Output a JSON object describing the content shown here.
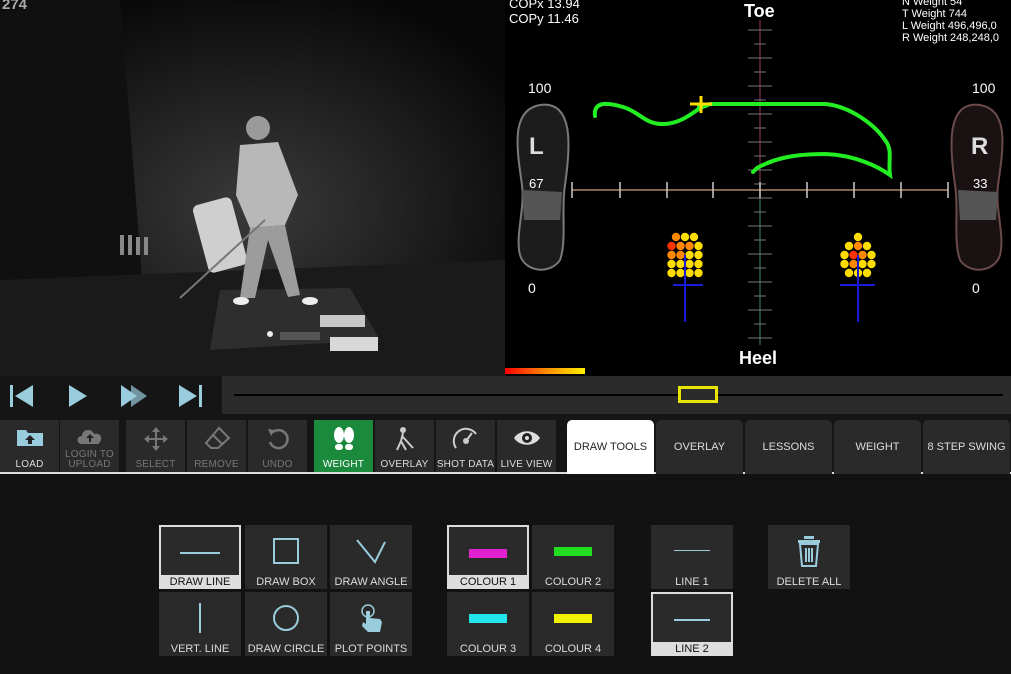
{
  "video": {
    "frame_counter": "274"
  },
  "pressure": {
    "copx": "COPx 13.94",
    "copy": "COPy 11.46",
    "toe_label": "Toe",
    "heel_label": "Heel",
    "weights": [
      "N Weight 54",
      "T Weight 744",
      "L Weight 496,496,0",
      "R Weight 248,248,0"
    ],
    "left_foot": {
      "letter": "L",
      "max": "100",
      "value": "67",
      "min": "0"
    },
    "right_foot": {
      "letter": "R",
      "max": "100",
      "value": "33",
      "min": "0"
    }
  },
  "playback": {
    "position": 0.59
  },
  "toolbar": {
    "tools": [
      {
        "label": "LOAD",
        "icon": "folder-upload-icon",
        "state": "enabled"
      },
      {
        "label": "LOGIN TO",
        "label2": "UPLOAD",
        "icon": "cloud-upload-icon",
        "state": "disabled"
      },
      {
        "label": "SELECT",
        "icon": "move-icon",
        "state": "disabled"
      },
      {
        "label": "REMOVE",
        "icon": "eraser-icon",
        "state": "disabled"
      },
      {
        "label": "UNDO",
        "icon": "undo-icon",
        "state": "disabled"
      },
      {
        "label": "WEIGHT",
        "icon": "footprints-icon",
        "state": "active"
      },
      {
        "label": "OVERLAY",
        "icon": "golfer-icon",
        "state": "enabled"
      },
      {
        "label": "SHOT DATA",
        "icon": "shot-data-icon",
        "state": "enabled"
      },
      {
        "label": "LIVE VIEW",
        "icon": "eye-icon",
        "state": "enabled"
      }
    ],
    "tabs": [
      "DRAW TOOLS",
      "OVERLAY",
      "LESSONS",
      "WEIGHT",
      "8 STEP SWING"
    ],
    "active_tab": "DRAW TOOLS"
  },
  "draw_tools": {
    "shapes": [
      "DRAW LINE",
      "DRAW BOX",
      "DRAW ANGLE",
      "VERT. LINE",
      "DRAW CIRCLE",
      "PLOT POINTS"
    ],
    "selected_shape": "DRAW LINE",
    "colours": [
      {
        "label": "COLOUR 1",
        "color": "#e020d0"
      },
      {
        "label": "COLOUR 2",
        "color": "#22dd22"
      },
      {
        "label": "COLOUR 3",
        "color": "#22e6ee"
      },
      {
        "label": "COLOUR 4",
        "color": "#f2f200"
      }
    ],
    "selected_colour": "COLOUR 1",
    "lines": [
      "LINE 1",
      "LINE 2"
    ],
    "selected_line": "LINE 2",
    "delete_all": "DELETE ALL"
  },
  "colors": {
    "accent_green": "#1c8a3c",
    "trace_green": "#22ee22",
    "handle_yellow": "#e6e600"
  }
}
